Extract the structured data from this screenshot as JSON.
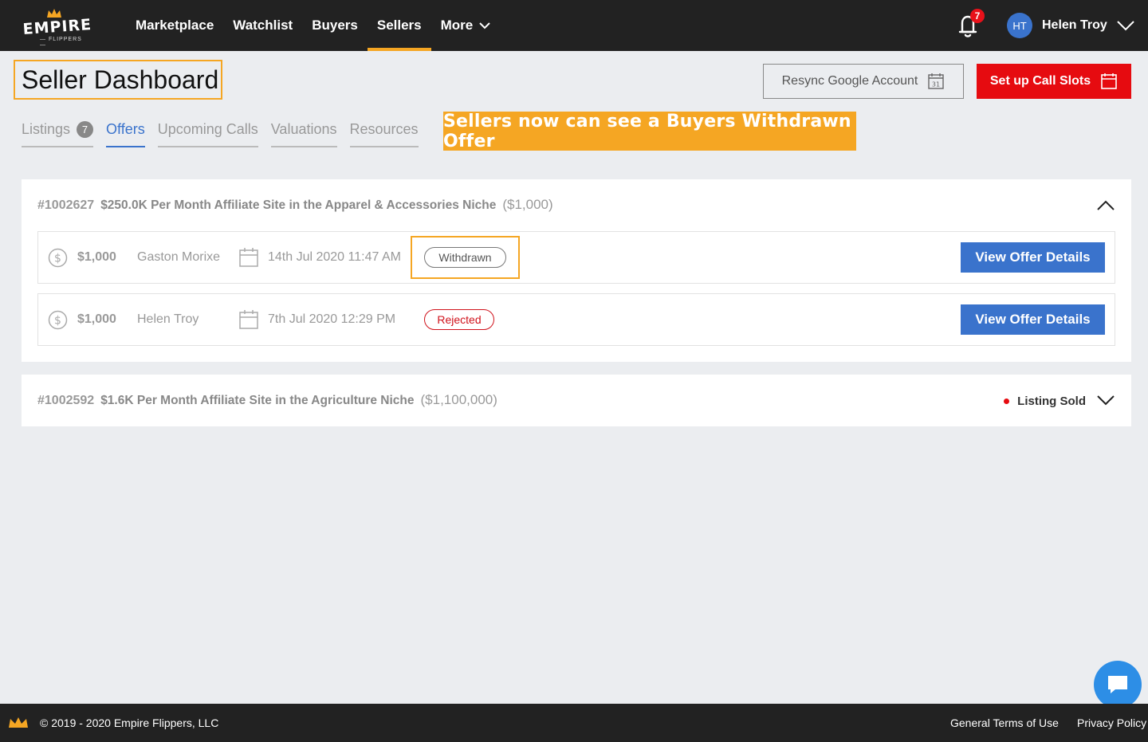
{
  "nav": {
    "logo_word": "EMPIRE",
    "logo_sub": "— FLIPPERS —",
    "items": [
      {
        "label": "Marketplace"
      },
      {
        "label": "Watchlist"
      },
      {
        "label": "Buyers"
      },
      {
        "label": "Sellers"
      },
      {
        "label": "More"
      }
    ],
    "active_item": "Sellers",
    "notifications_count": "7",
    "user_initials": "HT",
    "user_name": "Helen Troy"
  },
  "header": {
    "title": "Seller Dashboard",
    "resync_label": "Resync Google Account",
    "calendar_day": "31",
    "setup_label": "Set up Call Slots"
  },
  "tabs": [
    {
      "label": "Listings",
      "count": "7"
    },
    {
      "label": "Offers"
    },
    {
      "label": "Upcoming Calls"
    },
    {
      "label": "Valuations"
    },
    {
      "label": "Resources"
    }
  ],
  "active_tab": "Offers",
  "banner": "Sellers now can see a Buyers Withdrawn Offer",
  "listings": [
    {
      "id": "#1002627",
      "title": "$250.0K Per Month Affiliate Site in the Apparel & Accessories Niche",
      "price": "($1,000)",
      "offers": [
        {
          "amount": "$1,000",
          "buyer": "Gaston Morixe",
          "date": "14th Jul 2020 11:47 AM",
          "status": "Withdrawn",
          "button": "View Offer Details"
        },
        {
          "amount": "$1,000",
          "buyer": "Helen Troy",
          "date": "7th Jul 2020 12:29 PM",
          "status": "Rejected",
          "button": "View Offer Details"
        }
      ]
    },
    {
      "id": "#1002592",
      "title": "$1.6K Per Month Affiliate Site in the Agriculture Niche",
      "price": "($1,100,000)",
      "status": "Listing Sold"
    }
  ],
  "footer": {
    "copyright": "© 2019 - 2020 Empire Flippers, LLC",
    "terms": "General Terms of Use",
    "privacy": "Privacy Policy"
  },
  "colors": {
    "nav_bg": "#222222",
    "accent": "#f5a623",
    "primary_blue": "#3a73cc",
    "danger_red": "#e60b10"
  }
}
